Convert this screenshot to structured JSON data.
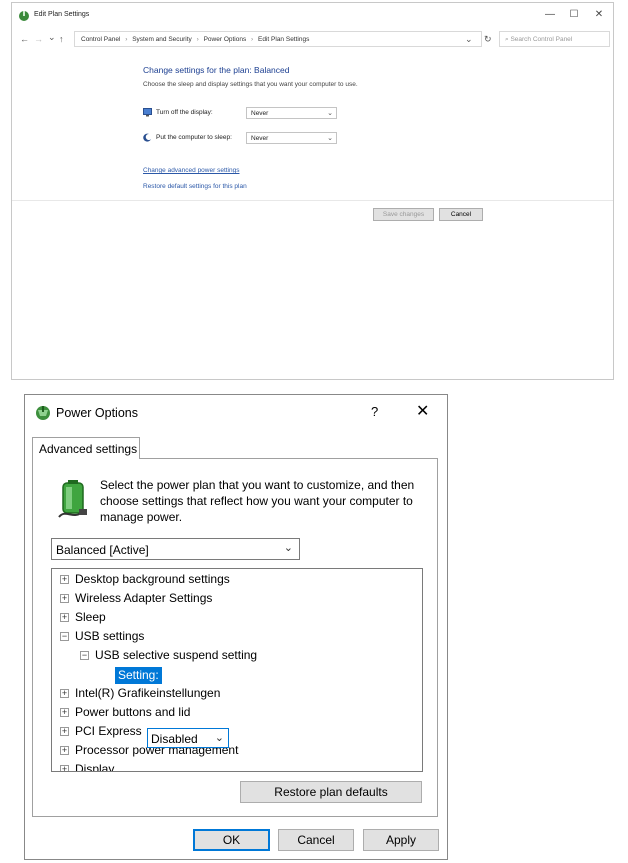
{
  "edit_plan_window": {
    "title": "Edit Plan Settings",
    "controls": {
      "minimize": "—",
      "maximize": "☐",
      "close": "✕"
    },
    "nav": {
      "back": "←",
      "forward": "→",
      "recent": "⌄",
      "up": "↑",
      "refresh": "↻",
      "dropdown": "⌄"
    },
    "breadcrumbs": [
      "Control Panel",
      "System and Security",
      "Power Options",
      "Edit Plan Settings"
    ],
    "breadcrumb_separator": "›",
    "search_placeholder": "Search Control Panel",
    "heading": "Change settings for the plan: Balanced",
    "subheading": "Choose the sleep and display settings that you want your computer to use.",
    "display_label": "Turn off the display:",
    "display_value": "Never",
    "sleep_label": "Put the computer to sleep:",
    "sleep_value": "Never",
    "advanced_link": "Change advanced power settings",
    "restore_link": "Restore default settings for this plan",
    "save_button": "Save changes",
    "cancel_button": "Cancel"
  },
  "power_options_dialog": {
    "title": "Power Options",
    "help": "?",
    "close": "✕",
    "tab": "Advanced settings",
    "intro": "Select the power plan that you want to customize, and then choose settings that reflect how you want your computer to manage power.",
    "plan_selected": "Balanced [Active]",
    "tree": [
      {
        "label": "Desktop background settings",
        "expander": "+"
      },
      {
        "label": "Wireless Adapter Settings",
        "expander": "+"
      },
      {
        "label": "Sleep",
        "expander": "+"
      },
      {
        "label": "USB settings",
        "expander": "−"
      },
      {
        "label": "USB selective suspend setting",
        "expander": "−"
      },
      {
        "label": "Intel(R) Grafikeinstellungen",
        "expander": "+"
      },
      {
        "label": "Power buttons and lid",
        "expander": "+"
      },
      {
        "label": "PCI Express",
        "expander": "+"
      },
      {
        "label": "Processor power management",
        "expander": "+"
      },
      {
        "label": "Display",
        "expander": "+"
      }
    ],
    "setting_label": "Setting:",
    "setting_value": "Disabled",
    "scroll_up": "⌃",
    "scroll_down": "⌄",
    "restore_button": "Restore plan defaults",
    "ok_button": "OK",
    "cancel_button": "Cancel",
    "apply_button": "Apply"
  },
  "colors": {
    "link": "#2b58a8",
    "heading": "#1c3f91",
    "selection": "#0078d7",
    "button_face": "#e1e1e1"
  },
  "icons": [
    "power-options-icon",
    "display-icon",
    "sleep-moon-icon",
    "battery-plug-icon",
    "chevron-down-icon",
    "expand-icon",
    "collapse-icon"
  ]
}
